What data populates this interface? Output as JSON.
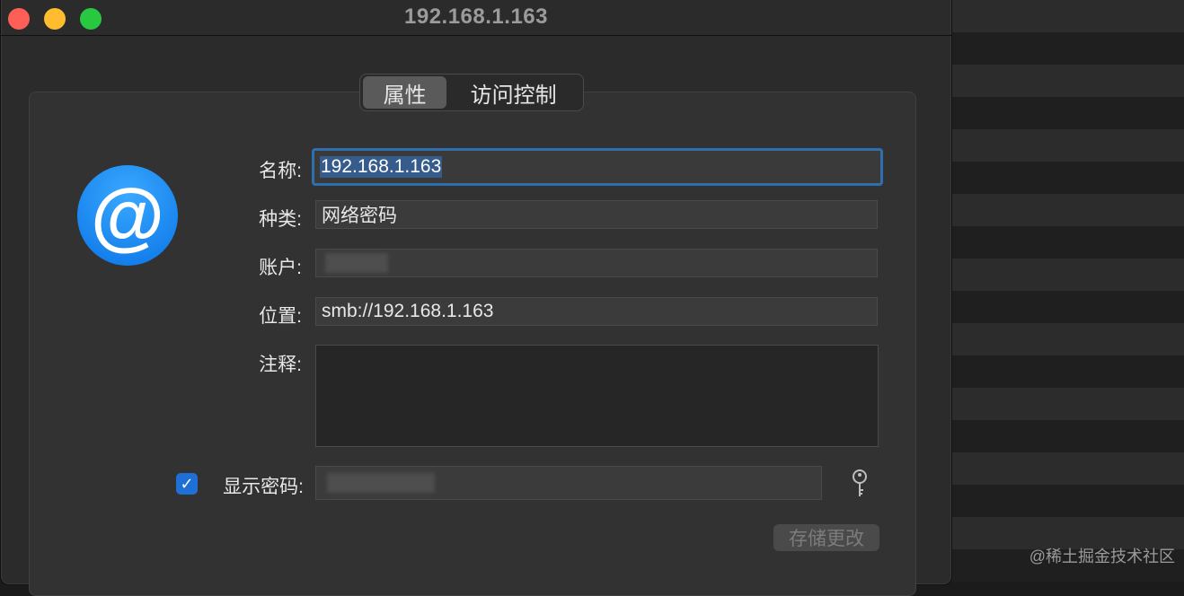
{
  "window": {
    "title": "192.168.1.163"
  },
  "tabs": [
    {
      "label": "属性",
      "active": true
    },
    {
      "label": "访问控制",
      "active": false
    }
  ],
  "icon": {
    "name": "at-sign-icon",
    "glyph": "@",
    "color": "#0a84ff"
  },
  "fields": {
    "name": {
      "label": "名称:",
      "value": "192.168.1.163"
    },
    "kind": {
      "label": "种类:",
      "value": "网络密码"
    },
    "account": {
      "label": "账户:",
      "value": ""
    },
    "location": {
      "label": "位置:",
      "value": "smb://192.168.1.163"
    },
    "comments": {
      "label": "注释:",
      "value": ""
    }
  },
  "show_password": {
    "label": "显示密码:",
    "checked": true,
    "value": ""
  },
  "save_button": {
    "label": "存储更改"
  },
  "watermark": "@稀土掘金技术社区",
  "colors": {
    "accent": "#2e6fb0",
    "checkbox": "#1e6fd6"
  }
}
